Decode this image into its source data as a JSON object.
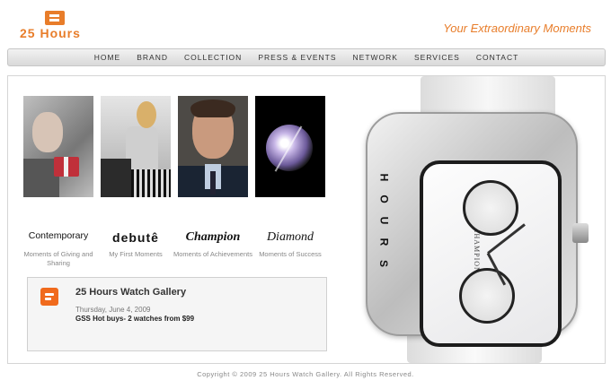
{
  "header": {
    "logo_text": "25 Hours",
    "tagline": "Your Extraordinary Moments"
  },
  "nav": {
    "items": [
      "HOME",
      "BRAND",
      "COLLECTION",
      "PRESS & EVENTS",
      "NETWORK",
      "SERVICES",
      "CONTACT"
    ]
  },
  "collections": [
    {
      "title": "Contemporary",
      "desc": "Moments of Giving and Sharing"
    },
    {
      "title": "debutê",
      "desc": "My First Moments"
    },
    {
      "title": "Champion",
      "desc": "Moments of Achievements"
    },
    {
      "title": "Diamond",
      "desc": "Moments of Success"
    }
  ],
  "blog": {
    "title": "25 Hours Watch Gallery",
    "date": "Thursday, June 4, 2009",
    "post": "GSS Hot buys- 2 watches from $99"
  },
  "watch": {
    "bezel_text": "HOURS",
    "dial_text": "CHAMPION"
  },
  "footer": {
    "copyright": "Copyright © 2009 25 Hours Watch Gallery. All Rights Reserved."
  },
  "colors": {
    "brand_orange": "#e87d2a",
    "blogger_orange": "#f06a1c"
  }
}
